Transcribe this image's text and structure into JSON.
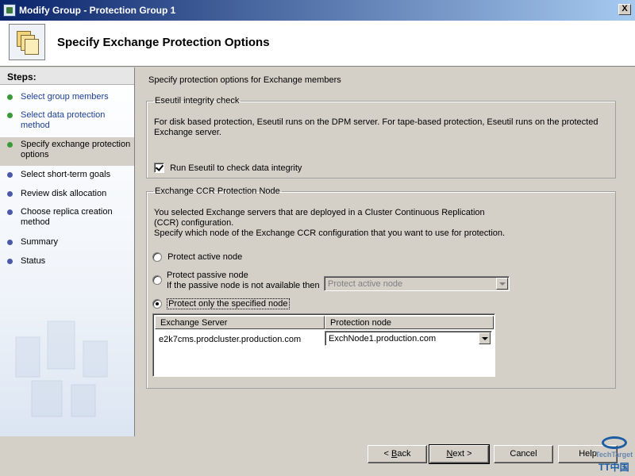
{
  "window": {
    "title": "Modify Group - Protection Group 1",
    "close_glyph": "X"
  },
  "header": {
    "title": "Specify Exchange Protection Options"
  },
  "sidebar": {
    "heading": "Steps:",
    "steps": [
      {
        "label": "Select group members",
        "state": "done"
      },
      {
        "label": "Select data protection method",
        "state": "done"
      },
      {
        "label": "Specify exchange protection options",
        "state": "current"
      },
      {
        "label": "Select short-term goals",
        "state": "todo"
      },
      {
        "label": "Review disk allocation",
        "state": "todo"
      },
      {
        "label": "Choose replica creation method",
        "state": "todo"
      },
      {
        "label": "Summary",
        "state": "todo"
      },
      {
        "label": "Status",
        "state": "todo"
      }
    ]
  },
  "main": {
    "intro": "Specify protection options for Exchange members",
    "eseutil": {
      "legend": "Eseutil integrity check",
      "description": "For disk based protection, Eseutil runs on the DPM server. For tape-based protection, Eseutil runs on the protected Exchange server.",
      "checkbox_label": "Run Eseutil to check data integrity",
      "checked": true
    },
    "ccr": {
      "legend": "Exchange CCR Protection Node",
      "description_1": "You selected Exchange servers that are deployed in a Cluster Continuous Replication (CCR) configuration.",
      "description_2": "Specify which node of the Exchange CCR configuration that you want to use for protection.",
      "radio_active": "Protect active node",
      "radio_passive": "Protect passive node",
      "passive_fallback": "If the passive node is not available then",
      "fallback_value": "Protect active node",
      "radio_specified": "Protect only the specified node",
      "selected": "specified",
      "grid": {
        "columns": [
          "Exchange Server",
          "Protection node"
        ],
        "rows": [
          {
            "server": "e2k7cms.prodcluster.production.com",
            "node": "ExchNode1.production.com"
          }
        ]
      }
    }
  },
  "buttons": {
    "back_prefix": "< ",
    "back_mnemonic": "B",
    "back_rest": "ack",
    "next_mnemonic": "N",
    "next_rest": "ext >",
    "cancel": "Cancel",
    "help": "Help"
  },
  "watermark": {
    "line1": "TechTarget",
    "line2": "TT中国"
  },
  "colors": {
    "title_bar": "#0a246a",
    "step_done": "#3a9a3a",
    "step_todo": "#4a5aa8",
    "face": "#d4d0c8"
  }
}
